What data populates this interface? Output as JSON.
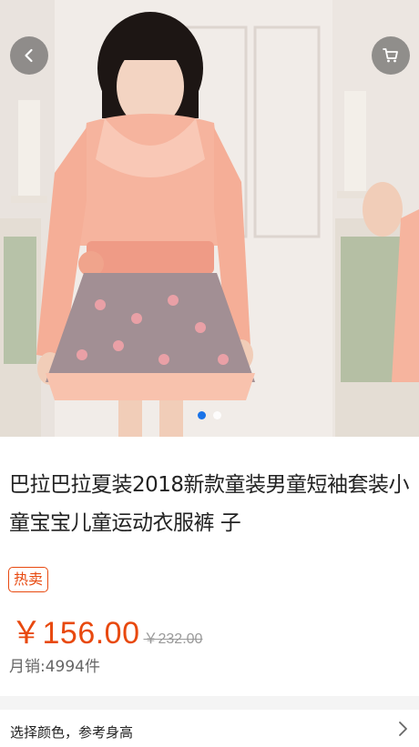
{
  "header": {
    "back_icon": "chevron-left-icon",
    "cart_icon": "cart-icon"
  },
  "gallery": {
    "image_description_icon": "product-photo",
    "slide_count": 2,
    "active_slide": 1
  },
  "product": {
    "title": "巴拉巴拉夏装2018新款童装男童短袖套装小童宝宝儿童运动衣服裤 子",
    "badge": "热卖",
    "price": "￥156.00",
    "old_price": "￥232.00",
    "sales": "月销:4994件"
  },
  "options": {
    "label": "选择颜色，参考身高",
    "chevron_icon": "chevron-right-icon"
  },
  "colors": {
    "accent": "#e8490f",
    "active_dot": "#1a73e8"
  }
}
